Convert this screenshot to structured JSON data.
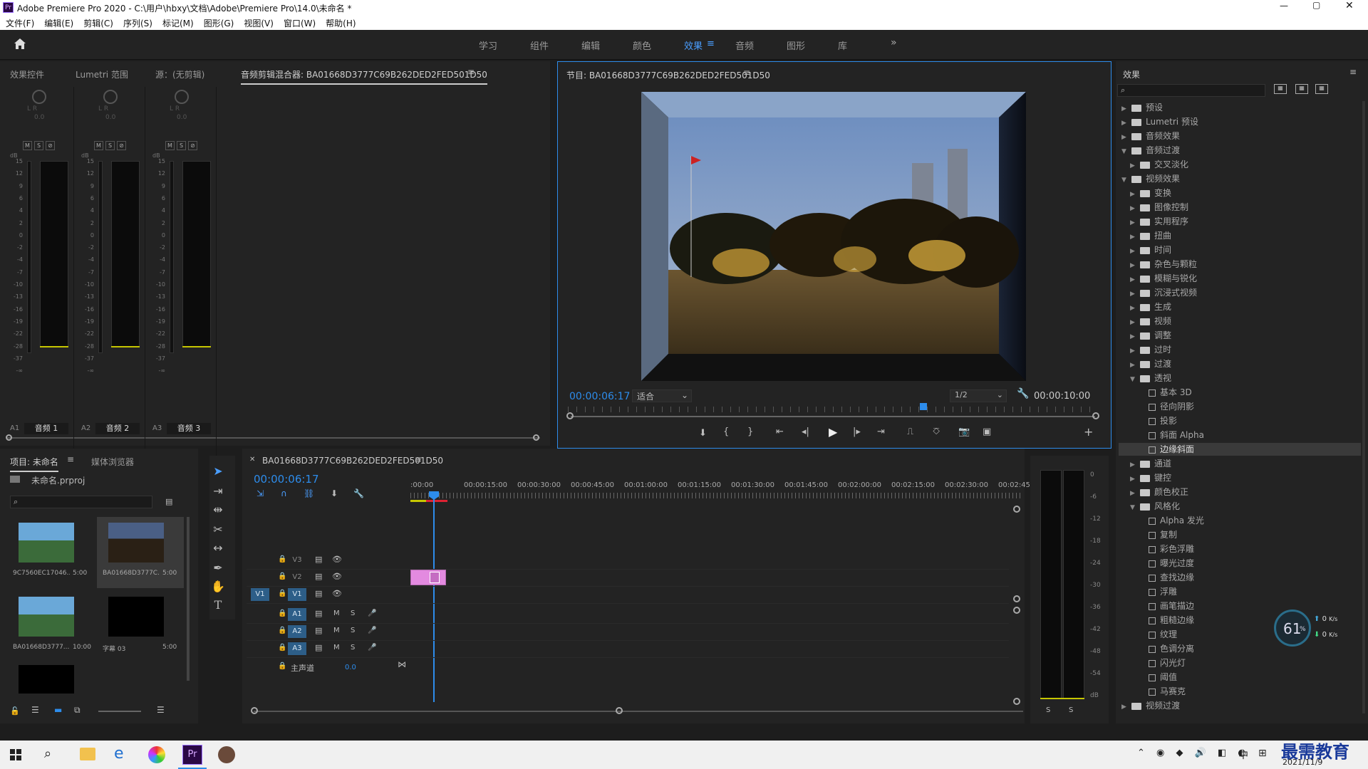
{
  "window": {
    "title": "Adobe Premiere Pro 2020 - C:\\用户\\hbxy\\文档\\Adobe\\Premiere Pro\\14.0\\未命名 *"
  },
  "menu": [
    "文件(F)",
    "编辑(E)",
    "剪辑(C)",
    "序列(S)",
    "标记(M)",
    "图形(G)",
    "视图(V)",
    "窗口(W)",
    "帮助(H)"
  ],
  "workspaces": [
    "学习",
    "组件",
    "编辑",
    "颜色",
    "效果",
    "音频",
    "图形",
    "库"
  ],
  "active_workspace": "效果",
  "source_panel": {
    "tabs": [
      "效果控件",
      "Lumetri 范围",
      "源：(无剪辑)",
      "音频剪辑混合器: BA01668D3777C69B262DED2FED501D50"
    ],
    "channels": [
      {
        "label": "音频 1",
        "id": "A1"
      },
      {
        "label": "音频 2",
        "id": "A2"
      },
      {
        "label": "音频 3",
        "id": "A3"
      }
    ],
    "msr": [
      "M",
      "S",
      "⊘"
    ],
    "db_ticks": [
      "15",
      "12",
      "9",
      "6",
      "4",
      "2",
      "0",
      "-2",
      "-4",
      "-7",
      "-10",
      "-13",
      "-16",
      "-19",
      "-22",
      "-28",
      "-37",
      "-∞"
    ],
    "db": "dB",
    "lr": "L R",
    "val": "0.0"
  },
  "program": {
    "title": "节目: BA01668D3777C69B262DED2FED501D50",
    "timecode": "00:00:06:17",
    "fit": "适合",
    "res": "1/2",
    "duration": "00:00:10:00"
  },
  "effects": {
    "title": "效果",
    "items": [
      {
        "l": "预设",
        "d": 0,
        "t": "folder",
        "a": "▶"
      },
      {
        "l": "Lumetri 预设",
        "d": 0,
        "t": "folder",
        "a": "▶"
      },
      {
        "l": "音频效果",
        "d": 0,
        "t": "folder",
        "a": "▶"
      },
      {
        "l": "音频过渡",
        "d": 0,
        "t": "folder",
        "a": "▼"
      },
      {
        "l": "交叉淡化",
        "d": 1,
        "t": "folder",
        "a": "▶"
      },
      {
        "l": "视频效果",
        "d": 0,
        "t": "folder",
        "a": "▼"
      },
      {
        "l": "变换",
        "d": 1,
        "t": "folder",
        "a": "▶"
      },
      {
        "l": "图像控制",
        "d": 1,
        "t": "folder",
        "a": "▶"
      },
      {
        "l": "实用程序",
        "d": 1,
        "t": "folder",
        "a": "▶"
      },
      {
        "l": "扭曲",
        "d": 1,
        "t": "folder",
        "a": "▶"
      },
      {
        "l": "时间",
        "d": 1,
        "t": "folder",
        "a": "▶"
      },
      {
        "l": "杂色与颗粒",
        "d": 1,
        "t": "folder",
        "a": "▶"
      },
      {
        "l": "模糊与锐化",
        "d": 1,
        "t": "folder",
        "a": "▶"
      },
      {
        "l": "沉浸式视频",
        "d": 1,
        "t": "folder",
        "a": "▶"
      },
      {
        "l": "生成",
        "d": 1,
        "t": "folder",
        "a": "▶"
      },
      {
        "l": "视频",
        "d": 1,
        "t": "folder",
        "a": "▶"
      },
      {
        "l": "调整",
        "d": 1,
        "t": "folder",
        "a": "▶"
      },
      {
        "l": "过时",
        "d": 1,
        "t": "folder",
        "a": "▶"
      },
      {
        "l": "过渡",
        "d": 1,
        "t": "folder",
        "a": "▶"
      },
      {
        "l": "透视",
        "d": 1,
        "t": "folder",
        "a": "▼"
      },
      {
        "l": "基本 3D",
        "d": 2,
        "t": "fx",
        "a": ""
      },
      {
        "l": "径向阴影",
        "d": 2,
        "t": "fx",
        "a": ""
      },
      {
        "l": "投影",
        "d": 2,
        "t": "fx",
        "a": ""
      },
      {
        "l": "斜面 Alpha",
        "d": 2,
        "t": "fx",
        "a": ""
      },
      {
        "l": "边缘斜面",
        "d": 2,
        "t": "fx",
        "a": "",
        "sel": true
      },
      {
        "l": "通道",
        "d": 1,
        "t": "folder",
        "a": "▶"
      },
      {
        "l": "键控",
        "d": 1,
        "t": "folder",
        "a": "▶"
      },
      {
        "l": "颜色校正",
        "d": 1,
        "t": "folder",
        "a": "▶"
      },
      {
        "l": "风格化",
        "d": 1,
        "t": "folder",
        "a": "▼"
      },
      {
        "l": "Alpha 发光",
        "d": 2,
        "t": "fx",
        "a": ""
      },
      {
        "l": "复制",
        "d": 2,
        "t": "fx",
        "a": ""
      },
      {
        "l": "彩色浮雕",
        "d": 2,
        "t": "fx",
        "a": ""
      },
      {
        "l": "曝光过度",
        "d": 2,
        "t": "fx",
        "a": ""
      },
      {
        "l": "查找边缘",
        "d": 2,
        "t": "fx",
        "a": ""
      },
      {
        "l": "浮雕",
        "d": 2,
        "t": "fx",
        "a": ""
      },
      {
        "l": "画笔描边",
        "d": 2,
        "t": "fx",
        "a": ""
      },
      {
        "l": "粗糙边缘",
        "d": 2,
        "t": "fx",
        "a": ""
      },
      {
        "l": "纹理",
        "d": 2,
        "t": "fx",
        "a": ""
      },
      {
        "l": "色调分离",
        "d": 2,
        "t": "fx",
        "a": ""
      },
      {
        "l": "闪光灯",
        "d": 2,
        "t": "fx",
        "a": ""
      },
      {
        "l": "阈值",
        "d": 2,
        "t": "fx",
        "a": ""
      },
      {
        "l": "马赛克",
        "d": 2,
        "t": "fx",
        "a": ""
      },
      {
        "l": "视频过渡",
        "d": 0,
        "t": "folder",
        "a": "▶"
      }
    ]
  },
  "project": {
    "tabs": [
      "项目: 未命名",
      "媒体浏览器"
    ],
    "file": "未命名.prproj",
    "items": [
      {
        "name": "9C7560EC17046...",
        "dur": "5:00"
      },
      {
        "name": "BA01668D3777C...",
        "dur": "5:00"
      },
      {
        "name": "BA01668D3777...",
        "dur": "10:00"
      },
      {
        "name": "字幕 03",
        "dur": "5:00"
      }
    ]
  },
  "timeline": {
    "tab": "BA01668D3777C69B262DED2FED501D50",
    "timecode": "00:00:06:17",
    "ruler": [
      ":00:00",
      "00:00:15:00",
      "00:00:30:00",
      "00:00:45:00",
      "00:01:00:00",
      "00:01:15:00",
      "00:01:30:00",
      "00:01:45:00",
      "00:02:00:00",
      "00:02:15:00",
      "00:02:30:00",
      "00:02:45:"
    ],
    "video_tracks": [
      "V3",
      "V2",
      "V1"
    ],
    "audio_tracks": [
      "A1",
      "A2",
      "A3"
    ],
    "master": "主声道",
    "master_val": "0.0",
    "src_v": "V1"
  },
  "meter2": {
    "ticks": [
      "0",
      "-6",
      "-12",
      "-18",
      "-24",
      "-30",
      "-36",
      "-42",
      "-48",
      "-54",
      "dB"
    ],
    "s": "S"
  },
  "widget": {
    "pct": "61",
    "unit": "%",
    "up": "0",
    "down": "0",
    "speed_unit": "K/s"
  },
  "taskbar": {
    "date": "2021/11/9",
    "ime": "中",
    "watermark": "最需教育"
  }
}
